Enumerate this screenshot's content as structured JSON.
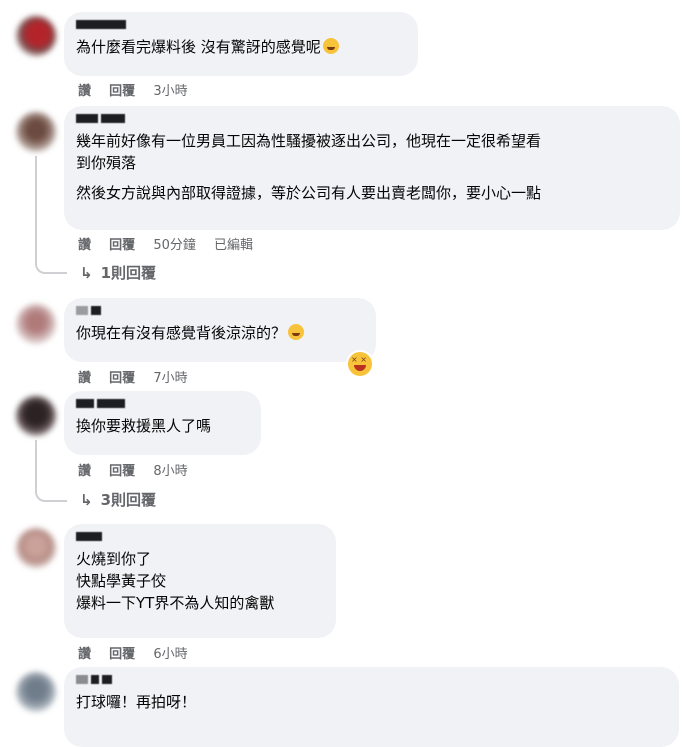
{
  "comments": [
    {
      "lines": [
        "為什麼看完爆料後 沒有驚訝的感覺呢"
      ],
      "actions": {
        "like": "讚",
        "reply": "回覆",
        "time": "3小時"
      }
    },
    {
      "lines": [
        "幾年前好像有一位男員工因為性騷擾被逐出公司，他現在一定很希望看",
        "到你殞落",
        "然後女方說與內部取得證據，等於公司有人要出賣老闆你，要小心一點"
      ],
      "actions": {
        "like": "讚",
        "reply": "回覆",
        "time": "50分鐘",
        "edited": "已編輯"
      },
      "replies": "1則回覆"
    },
    {
      "lines": [
        "你現在有沒有感覺背後涼涼的？"
      ],
      "actions": {
        "like": "讚",
        "reply": "回覆",
        "time": "7小時"
      }
    },
    {
      "lines": [
        "換你要救援黑人了嗎"
      ],
      "actions": {
        "like": "讚",
        "reply": "回覆",
        "time": "8小時"
      },
      "replies": "3則回覆"
    },
    {
      "lines": [
        "火燒到你了",
        "快點學黃子佼",
        "爆料一下YT界不為人知的禽獸"
      ],
      "actions": {
        "like": "讚",
        "reply": "回覆",
        "time": "6小時"
      }
    },
    {
      "lines": [
        "打球囉！再拍呀！"
      ]
    }
  ],
  "icons": [
    "grinning-sweat-emoji-icon",
    "smiling-sweat-emoji-icon",
    "laughing-reaction-icon",
    "reply-arrow-icon"
  ],
  "colors": {
    "bubble": "#f0f2f5",
    "meta": "#65676b",
    "text": "#050505"
  }
}
